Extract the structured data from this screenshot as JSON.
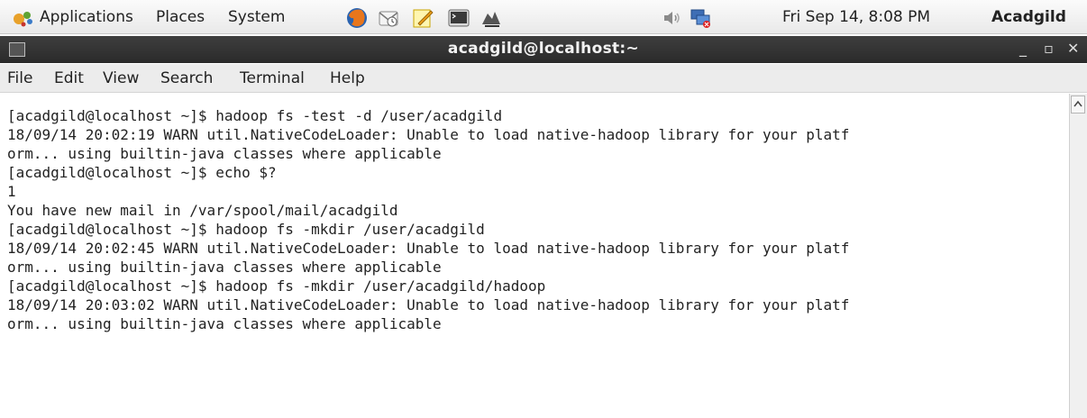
{
  "panel": {
    "applications": "Applications",
    "places": "Places",
    "system": "System",
    "clock": "Fri Sep 14,  8:08 PM",
    "user": "Acadgild",
    "icons": [
      "gnome-foot-icon",
      "firefox-icon",
      "evolution-mail-icon",
      "text-editor-icon",
      "terminal-icon",
      "screenshot-icon",
      "volume-icon",
      "network-icon"
    ]
  },
  "window": {
    "title": "acadgild@localhost:~",
    "minimize": "_",
    "maximize": "▫",
    "close": "✕"
  },
  "menu": {
    "file": "File",
    "edit": "Edit",
    "view": "View",
    "search": "Search",
    "terminal": "Terminal",
    "help": "Help"
  },
  "terminal": {
    "lines": [
      "[acadgild@localhost ~]$ hadoop fs -test -d /user/acadgild",
      "18/09/14 20:02:19 WARN util.NativeCodeLoader: Unable to load native-hadoop library for your platf",
      "orm... using builtin-java classes where applicable",
      "[acadgild@localhost ~]$ echo $?",
      "1",
      "You have new mail in /var/spool/mail/acadgild",
      "[acadgild@localhost ~]$ hadoop fs -mkdir /user/acadgild",
      "18/09/14 20:02:45 WARN util.NativeCodeLoader: Unable to load native-hadoop library for your platf",
      "orm... using builtin-java classes where applicable",
      "[acadgild@localhost ~]$ hadoop fs -mkdir /user/acadgild/hadoop",
      "18/09/14 20:03:02 WARN util.NativeCodeLoader: Unable to load native-hadoop library for your platf",
      "orm... using builtin-java classes where applicable"
    ]
  }
}
